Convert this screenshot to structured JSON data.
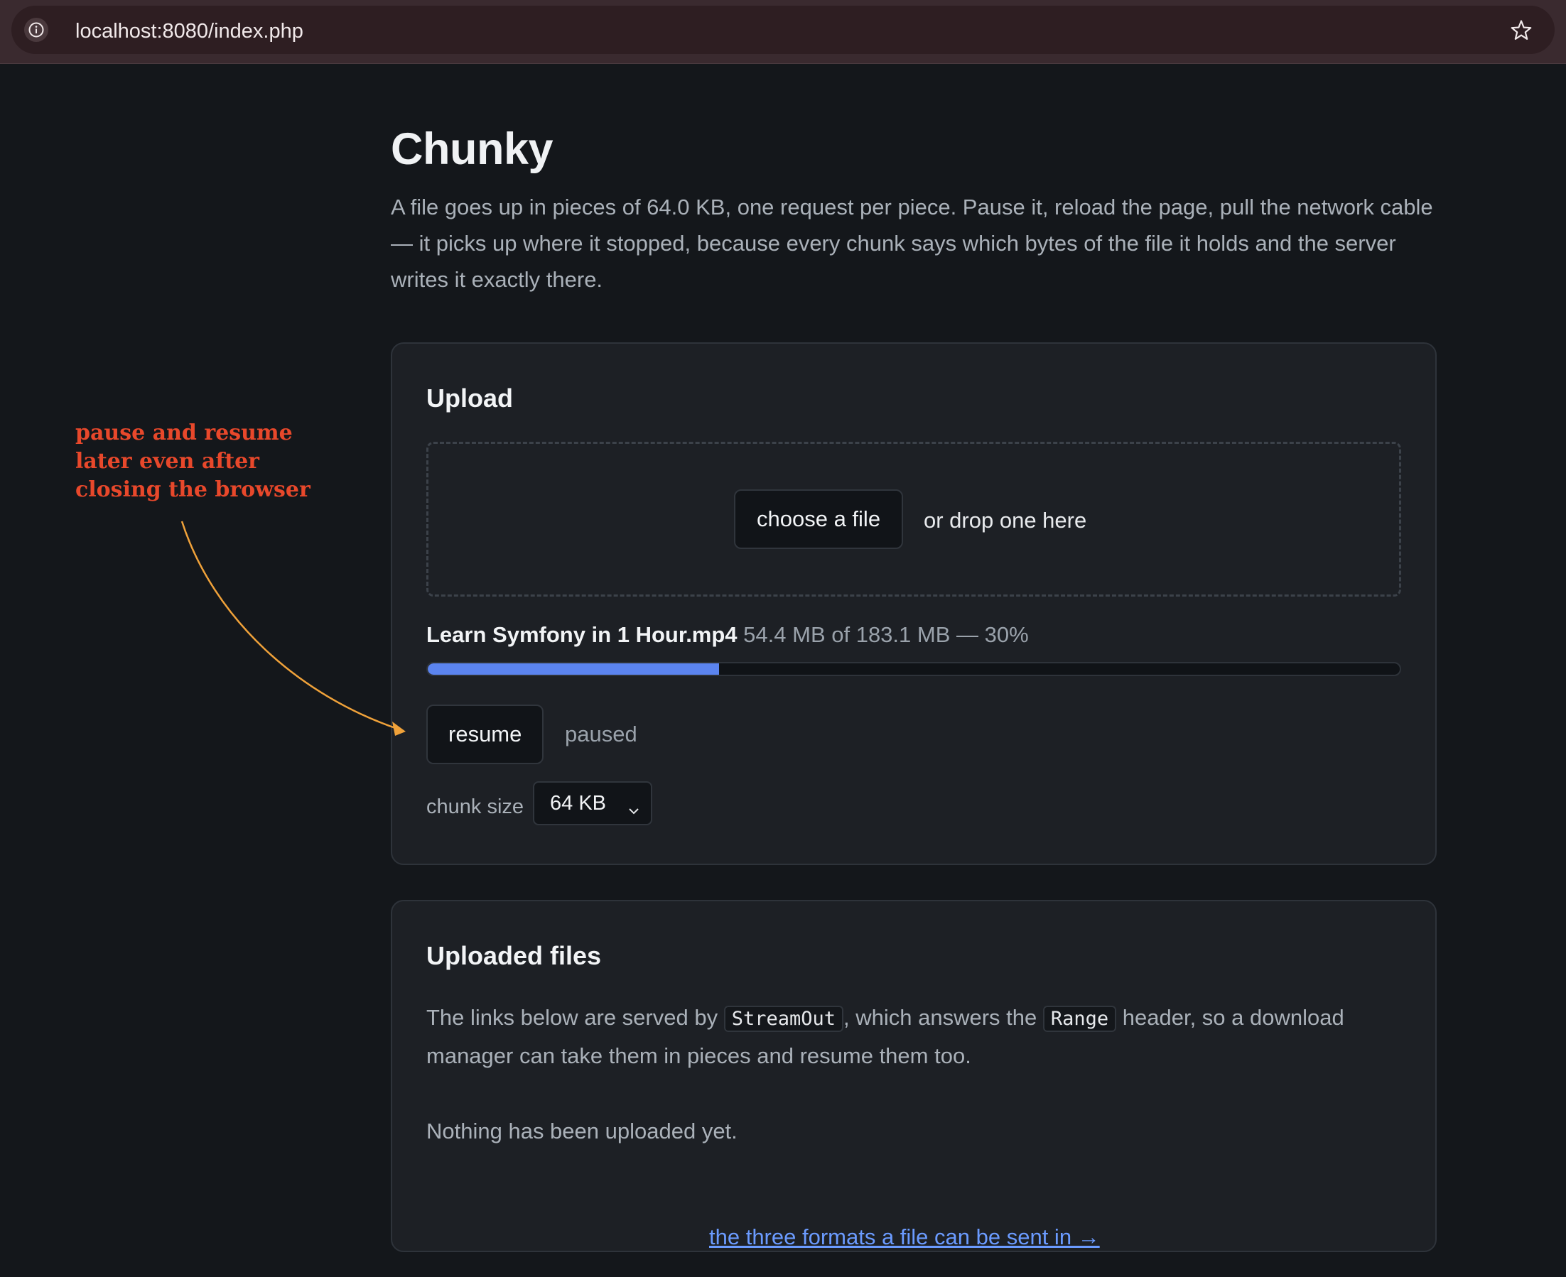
{
  "browser": {
    "url": "localhost:8080/index.php",
    "info_icon": "info-icon",
    "bookmark_icon": "star-icon"
  },
  "page": {
    "title": "Chunky",
    "intro": "A file goes up in pieces of 64.0 KB, one request per piece. Pause it, reload the page, pull the network cable — it picks up where it stopped, because every chunk says which bytes of the file it holds and the server writes it exactly there."
  },
  "upload": {
    "title": "Upload",
    "choose_button": "choose a file",
    "drop_text": "or drop one here",
    "file_name": "Learn Symfony in 1 Hour.mp4",
    "file_progress": "54.4 MB of 183.1 MB — 30%",
    "progress_percent": 30,
    "resume_button": "resume",
    "status": "paused",
    "chunk_label": "chunk size",
    "chunk_selected": "64 KB"
  },
  "files": {
    "title": "Uploaded files",
    "desc_part1": "The links below are served by ",
    "desc_code1": "StreamOut",
    "desc_part2": ", which answers the ",
    "desc_code2": "Range",
    "desc_part3": " header, so a download manager can take them in pieces and resume them too.",
    "empty": "Nothing has been uploaded yet."
  },
  "footer": {
    "link": "the three formats a file can be sent in →"
  },
  "annotation": {
    "text": "pause and resume later even after closing the browser"
  },
  "colors": {
    "accent": "#5b84ef",
    "link": "#6b9bff",
    "annotation": "#e8482b",
    "arrow": "#f0a23a"
  }
}
